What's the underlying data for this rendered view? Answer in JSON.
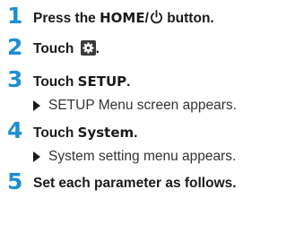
{
  "steps": [
    {
      "number": "1",
      "parts": [
        "Press the ",
        "HOME",
        "/",
        " button."
      ],
      "icon": "power-icon"
    },
    {
      "number": "2",
      "parts": [
        "Touch ",
        "."
      ],
      "icon": "settings-gear-icon"
    },
    {
      "number": "3",
      "parts": [
        "Touch ",
        "SETUP",
        "."
      ],
      "result": "SETUP Menu screen appears."
    },
    {
      "number": "4",
      "parts": [
        "Touch ",
        "System",
        "."
      ],
      "result": "System setting menu appears."
    },
    {
      "number": "5",
      "parts": [
        "Set each parameter as follows."
      ]
    }
  ],
  "colors": {
    "step_number": "#1e8fd3",
    "text": "#1a1a1a"
  }
}
